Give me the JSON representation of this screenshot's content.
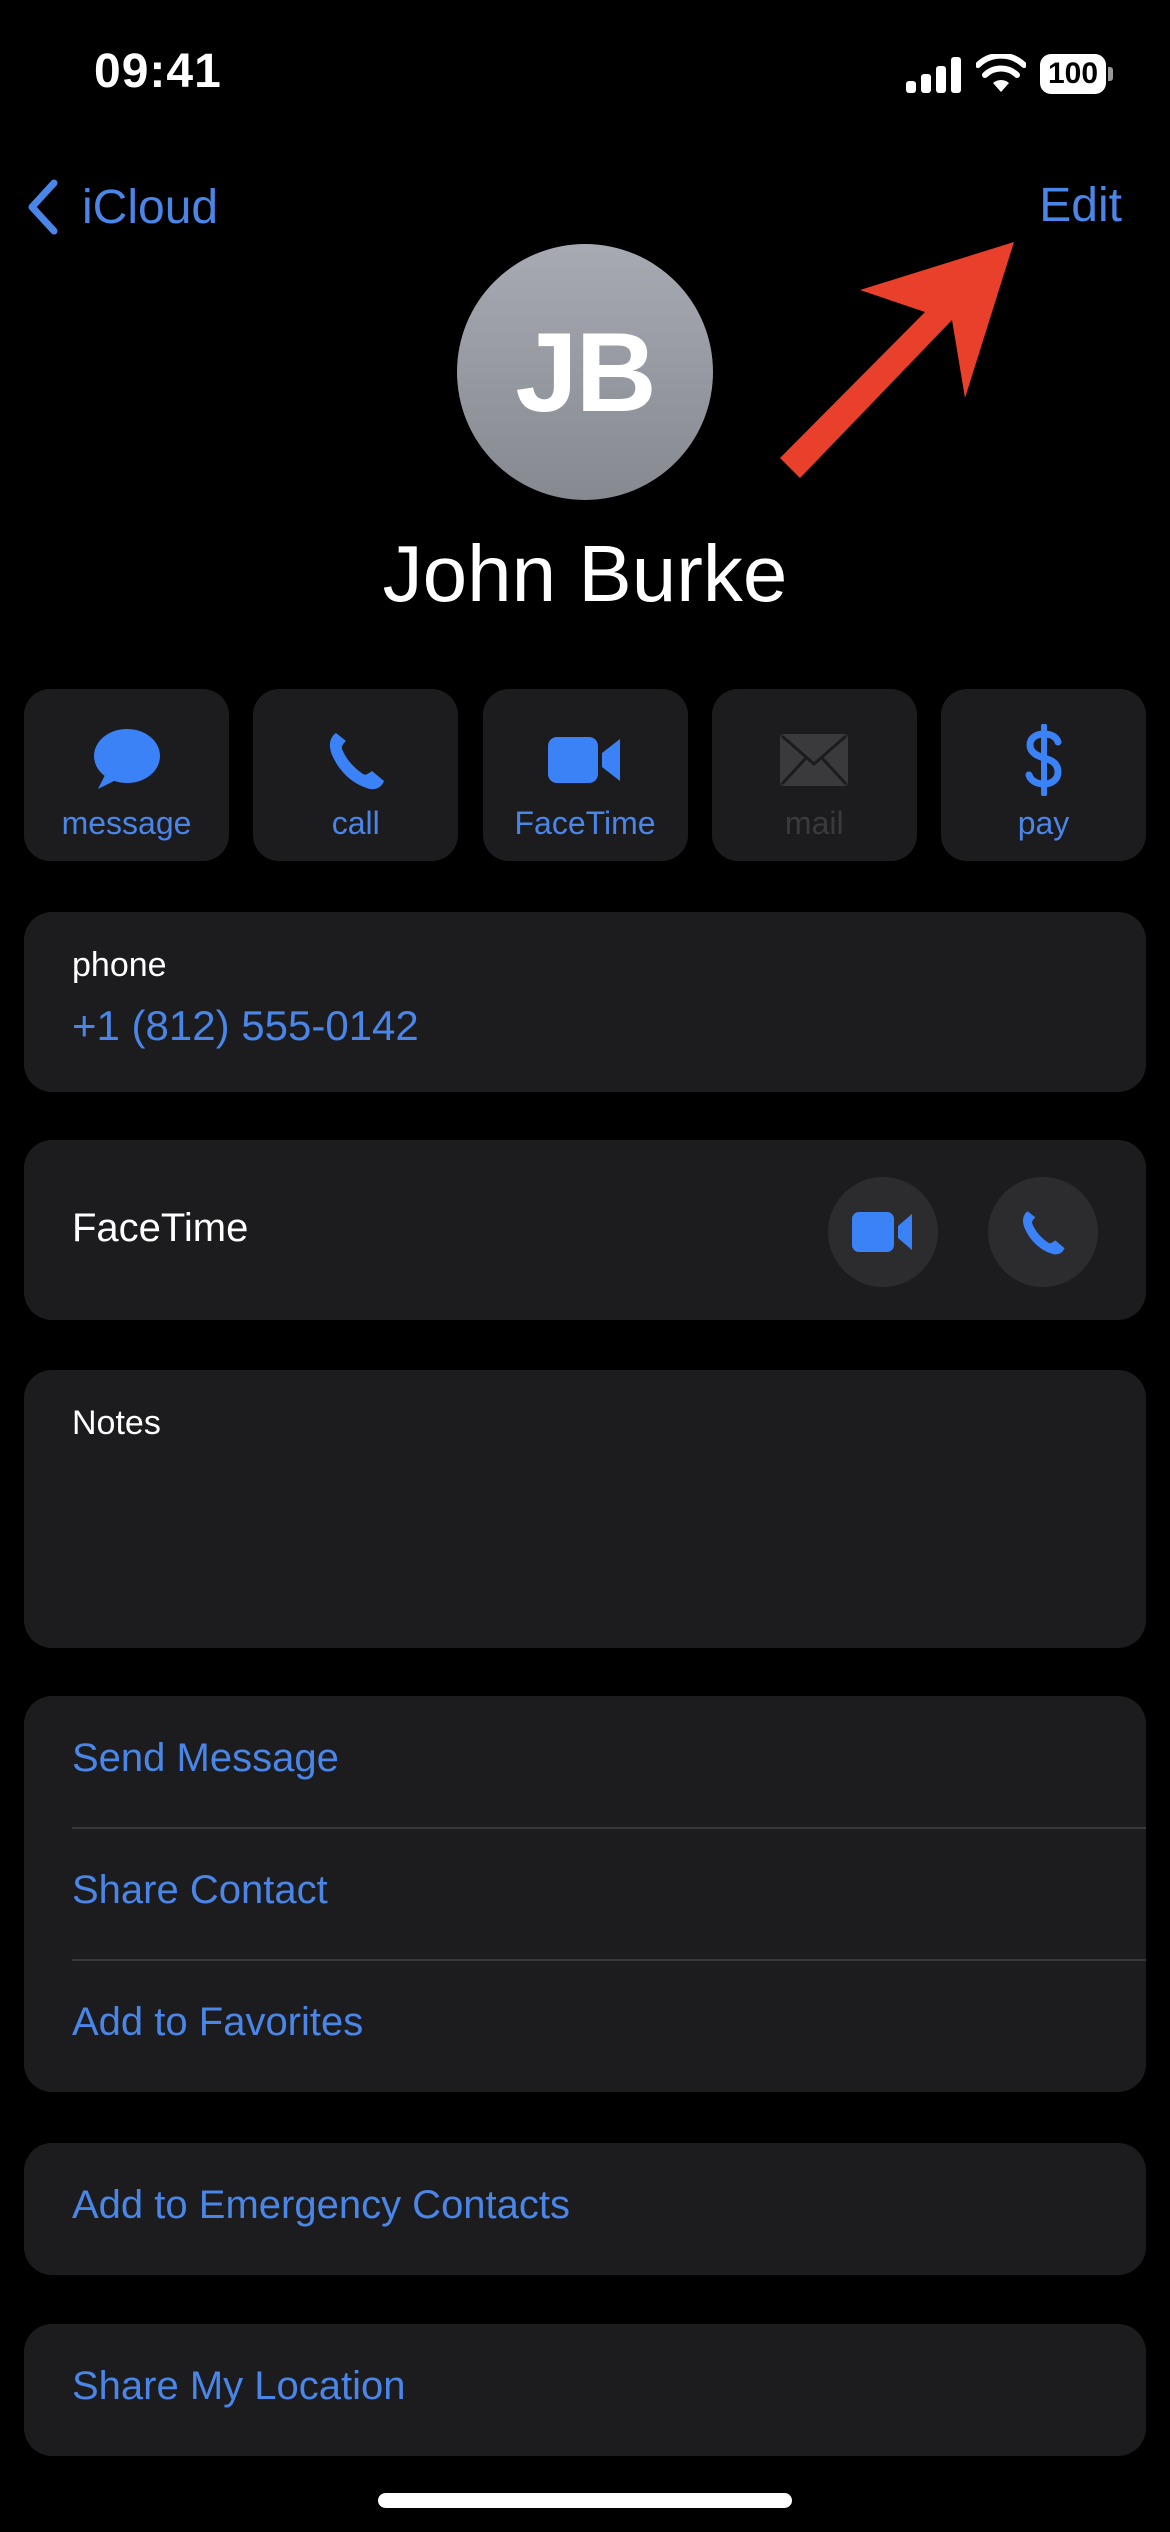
{
  "status_bar": {
    "time": "09:41",
    "battery_level": "100",
    "signal_icon": "cellular-signal-icon",
    "wifi_icon": "wifi-icon"
  },
  "nav": {
    "back_label": "iCloud",
    "edit_label": "Edit"
  },
  "contact": {
    "initials": "JB",
    "name": "John Burke"
  },
  "annotation": {
    "arrow_color": "#e8402a",
    "points_to": "Edit"
  },
  "actions": [
    {
      "label": "message",
      "icon": "message-bubble-icon",
      "enabled": true
    },
    {
      "label": "call",
      "icon": "phone-icon",
      "enabled": true
    },
    {
      "label": "FaceTime",
      "icon": "video-camera-icon",
      "enabled": true
    },
    {
      "label": "mail",
      "icon": "envelope-icon",
      "enabled": false
    },
    {
      "label": "pay",
      "icon": "dollar-sign-icon",
      "enabled": true
    }
  ],
  "phone": {
    "label": "phone",
    "value": "+1 (812) 555-0142"
  },
  "facetime": {
    "label": "FaceTime",
    "video_icon": "video-camera-icon",
    "audio_icon": "phone-icon"
  },
  "notes": {
    "label": "Notes",
    "value": ""
  },
  "options": [
    {
      "label": "Send Message"
    },
    {
      "label": "Share Contact"
    },
    {
      "label": "Add to Favorites"
    }
  ],
  "emergency": {
    "label": "Add to Emergency Contacts"
  },
  "location": {
    "label": "Share My Location"
  },
  "colors": {
    "accent": "#4a85e8",
    "background": "#000000",
    "card": "#1c1c1e",
    "disabled": "#3a3a3c"
  }
}
